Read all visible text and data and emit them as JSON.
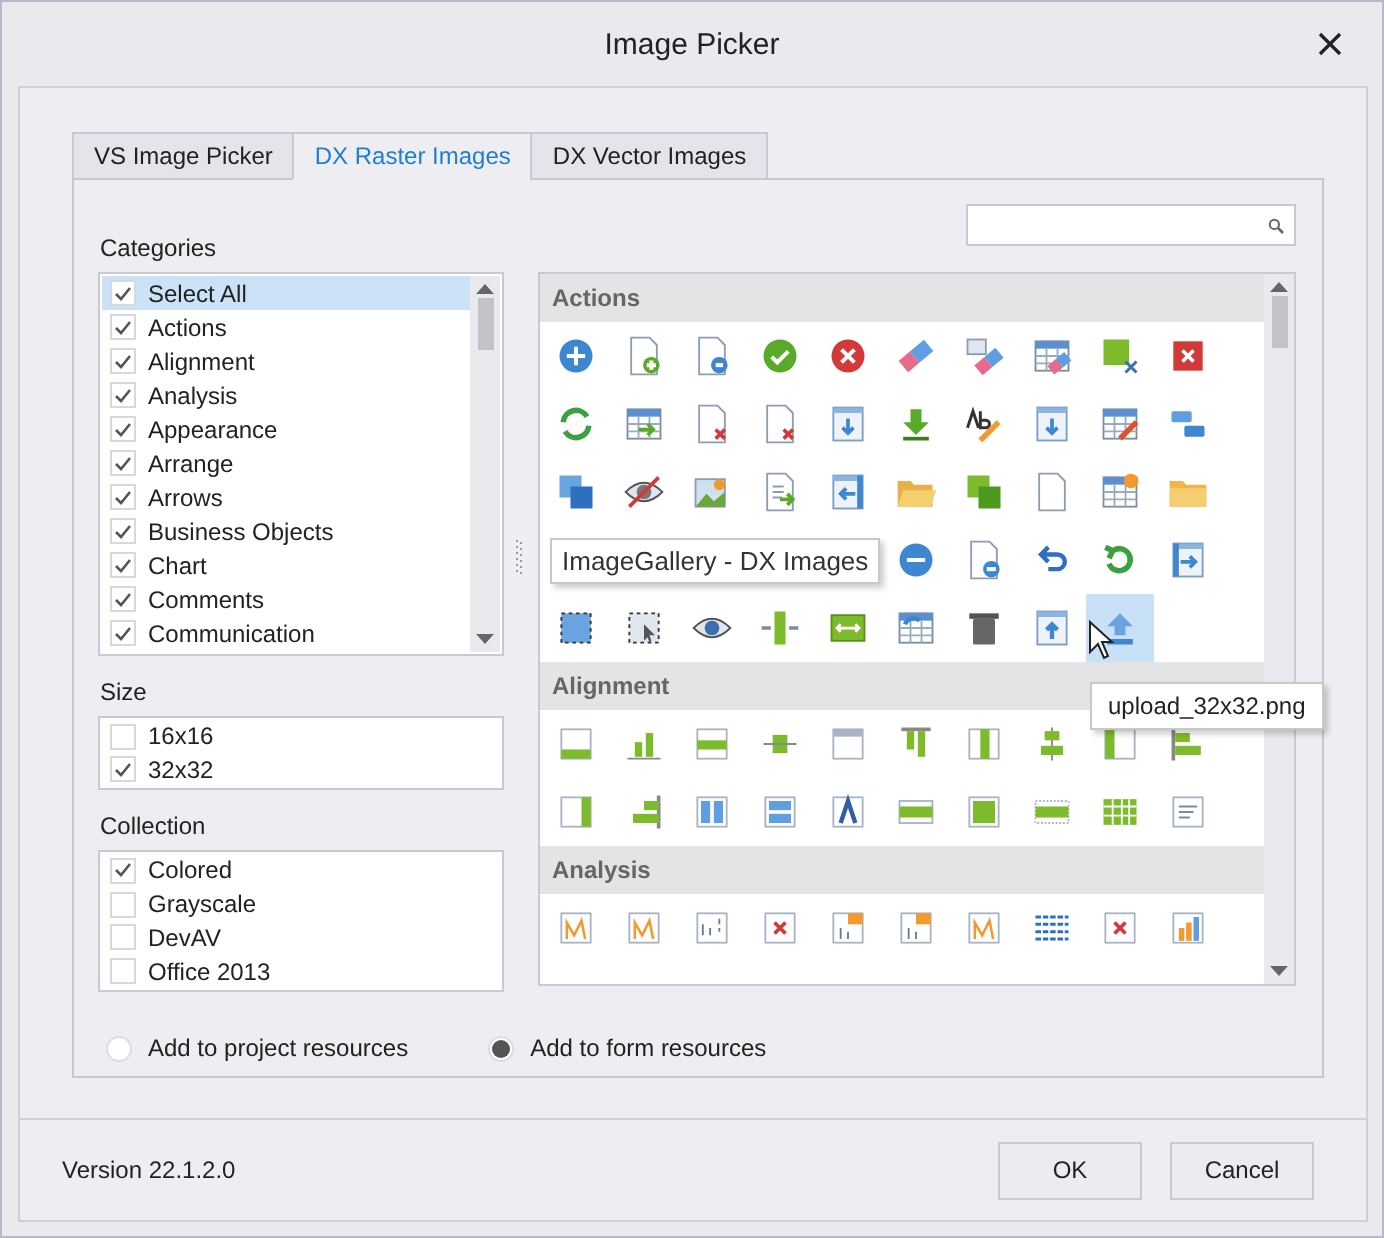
{
  "window": {
    "title": "Image Picker"
  },
  "tabs": [
    {
      "label": "VS Image Picker",
      "selected": false
    },
    {
      "label": "DX Raster Images",
      "selected": true
    },
    {
      "label": "DX Vector Images",
      "selected": false
    }
  ],
  "categories": {
    "label": "Categories",
    "items": [
      {
        "label": "Select All",
        "checked": true,
        "selected": true
      },
      {
        "label": "Actions",
        "checked": true,
        "selected": false
      },
      {
        "label": "Alignment",
        "checked": true,
        "selected": false
      },
      {
        "label": "Analysis",
        "checked": true,
        "selected": false
      },
      {
        "label": "Appearance",
        "checked": true,
        "selected": false
      },
      {
        "label": "Arrange",
        "checked": true,
        "selected": false
      },
      {
        "label": "Arrows",
        "checked": true,
        "selected": false
      },
      {
        "label": "Business Objects",
        "checked": true,
        "selected": false
      },
      {
        "label": "Chart",
        "checked": true,
        "selected": false
      },
      {
        "label": "Comments",
        "checked": true,
        "selected": false
      },
      {
        "label": "Communication",
        "checked": true,
        "selected": false
      }
    ]
  },
  "size": {
    "label": "Size",
    "items": [
      {
        "label": "16x16",
        "checked": false
      },
      {
        "label": "32x32",
        "checked": true
      }
    ]
  },
  "collection": {
    "label": "Collection",
    "items": [
      {
        "label": "Colored",
        "checked": true
      },
      {
        "label": "Grayscale",
        "checked": false
      },
      {
        "label": "DevAV",
        "checked": false
      },
      {
        "label": "Office 2013",
        "checked": false
      }
    ]
  },
  "resource_options": [
    {
      "label": "Add to project resources",
      "selected": false
    },
    {
      "label": "Add to form resources",
      "selected": true
    }
  ],
  "gallery": {
    "sections": [
      {
        "title": "Actions",
        "rows": [
          {
            "icons": [
              {
                "kind": "plus-circle",
                "selected": false
              },
              {
                "kind": "document-plus",
                "selected": false
              },
              {
                "kind": "document-gear",
                "selected": false
              },
              {
                "kind": "check-circle",
                "selected": false
              },
              {
                "kind": "cross-circle",
                "selected": false
              },
              {
                "kind": "eraser",
                "selected": false
              },
              {
                "kind": "picture-eraser",
                "selected": false
              },
              {
                "kind": "table-eraser",
                "selected": false
              },
              {
                "kind": "shape-edit",
                "selected": false
              },
              {
                "kind": "square-cross",
                "selected": false
              }
            ]
          },
          {
            "icons": [
              {
                "kind": "refresh",
                "selected": false
              },
              {
                "kind": "table-arrow",
                "selected": false
              },
              {
                "kind": "document-cross",
                "selected": false
              },
              {
                "kind": "document-cross",
                "selected": false
              },
              {
                "kind": "window-down",
                "selected": false
              },
              {
                "kind": "download",
                "selected": false
              },
              {
                "kind": "text-pen",
                "selected": false
              },
              {
                "kind": "window-down",
                "selected": false
              },
              {
                "kind": "table-pen",
                "selected": false
              },
              {
                "kind": "blocks",
                "selected": false
              }
            ]
          },
          {
            "icons": [
              {
                "kind": "squares",
                "selected": false
              },
              {
                "kind": "eye-off",
                "selected": false
              },
              {
                "kind": "picture",
                "selected": false
              },
              {
                "kind": "document-arrow",
                "selected": false
              },
              {
                "kind": "window-left",
                "selected": false
              },
              {
                "kind": "folder-open",
                "selected": false
              },
              {
                "kind": "stacked-squares",
                "selected": false
              },
              {
                "kind": "document",
                "selected": false
              },
              {
                "kind": "table-star",
                "selected": false
              },
              {
                "kind": "folder",
                "selected": false
              }
            ]
          },
          {
            "tooltip": "ImageGallery - DX Images",
            "icons": [
              {
                "kind": "minus-circle",
                "selected": false
              },
              {
                "kind": "document-minus",
                "selected": false
              },
              {
                "kind": "undo",
                "selected": false
              },
              {
                "kind": "redo",
                "selected": false
              },
              {
                "kind": "window-right",
                "selected": false
              }
            ]
          },
          {
            "icons": [
              {
                "kind": "dashed-square",
                "selected": false
              },
              {
                "kind": "dashed-pointer",
                "selected": false
              },
              {
                "kind": "eye",
                "selected": false
              },
              {
                "kind": "split-vertical",
                "selected": false
              },
              {
                "kind": "resize",
                "selected": false
              },
              {
                "kind": "table-refresh",
                "selected": false
              },
              {
                "kind": "trash",
                "selected": false
              },
              {
                "kind": "upload-box",
                "selected": false
              },
              {
                "kind": "upload",
                "selected": true,
                "tooltip": "upload_32x32.png"
              }
            ]
          }
        ]
      },
      {
        "title": "Alignment",
        "rows": [
          {
            "icons": [
              {
                "kind": "panel-bottom",
                "selected": false
              },
              {
                "kind": "bars-baseline",
                "selected": false
              },
              {
                "kind": "panel-middle",
                "selected": false
              },
              {
                "kind": "bar-centered",
                "selected": false
              },
              {
                "kind": "panel-top",
                "selected": false
              },
              {
                "kind": "bars-top",
                "selected": false
              },
              {
                "kind": "panel-column",
                "selected": false
              },
              {
                "kind": "bars-centered",
                "selected": false
              },
              {
                "kind": "panel-left",
                "selected": false
              },
              {
                "kind": "bars-left",
                "selected": false
              }
            ]
          },
          {
            "icons": [
              {
                "kind": "panel-right",
                "selected": false
              },
              {
                "kind": "bars-right",
                "selected": false
              },
              {
                "kind": "two-columns",
                "selected": false
              },
              {
                "kind": "two-rows",
                "selected": false
              },
              {
                "kind": "triangle-frame",
                "selected": false
              },
              {
                "kind": "bar-track",
                "selected": false
              },
              {
                "kind": "filled-panel",
                "selected": false
              },
              {
                "kind": "dotted-track",
                "selected": false
              },
              {
                "kind": "grid",
                "selected": false
              },
              {
                "kind": "form",
                "selected": false
              }
            ]
          }
        ]
      },
      {
        "title": "Analysis",
        "rows": [
          {
            "icons": [
              {
                "kind": "chart-frame",
                "selected": false
              },
              {
                "kind": "chart-frame",
                "selected": false
              },
              {
                "kind": "list-bracket",
                "selected": false
              },
              {
                "kind": "chart-cross",
                "selected": false
              },
              {
                "kind": "chart-badge",
                "selected": false
              },
              {
                "kind": "chart-badge",
                "selected": false
              },
              {
                "kind": "chart-frame",
                "selected": false
              },
              {
                "kind": "lines-dashed",
                "selected": false
              },
              {
                "kind": "chart-cross",
                "selected": false
              },
              {
                "kind": "chart-bars",
                "selected": false
              }
            ]
          }
        ]
      }
    ]
  },
  "footer": {
    "version": "Version 22.1.2.0",
    "buttons": [
      "OK",
      "Cancel"
    ]
  }
}
